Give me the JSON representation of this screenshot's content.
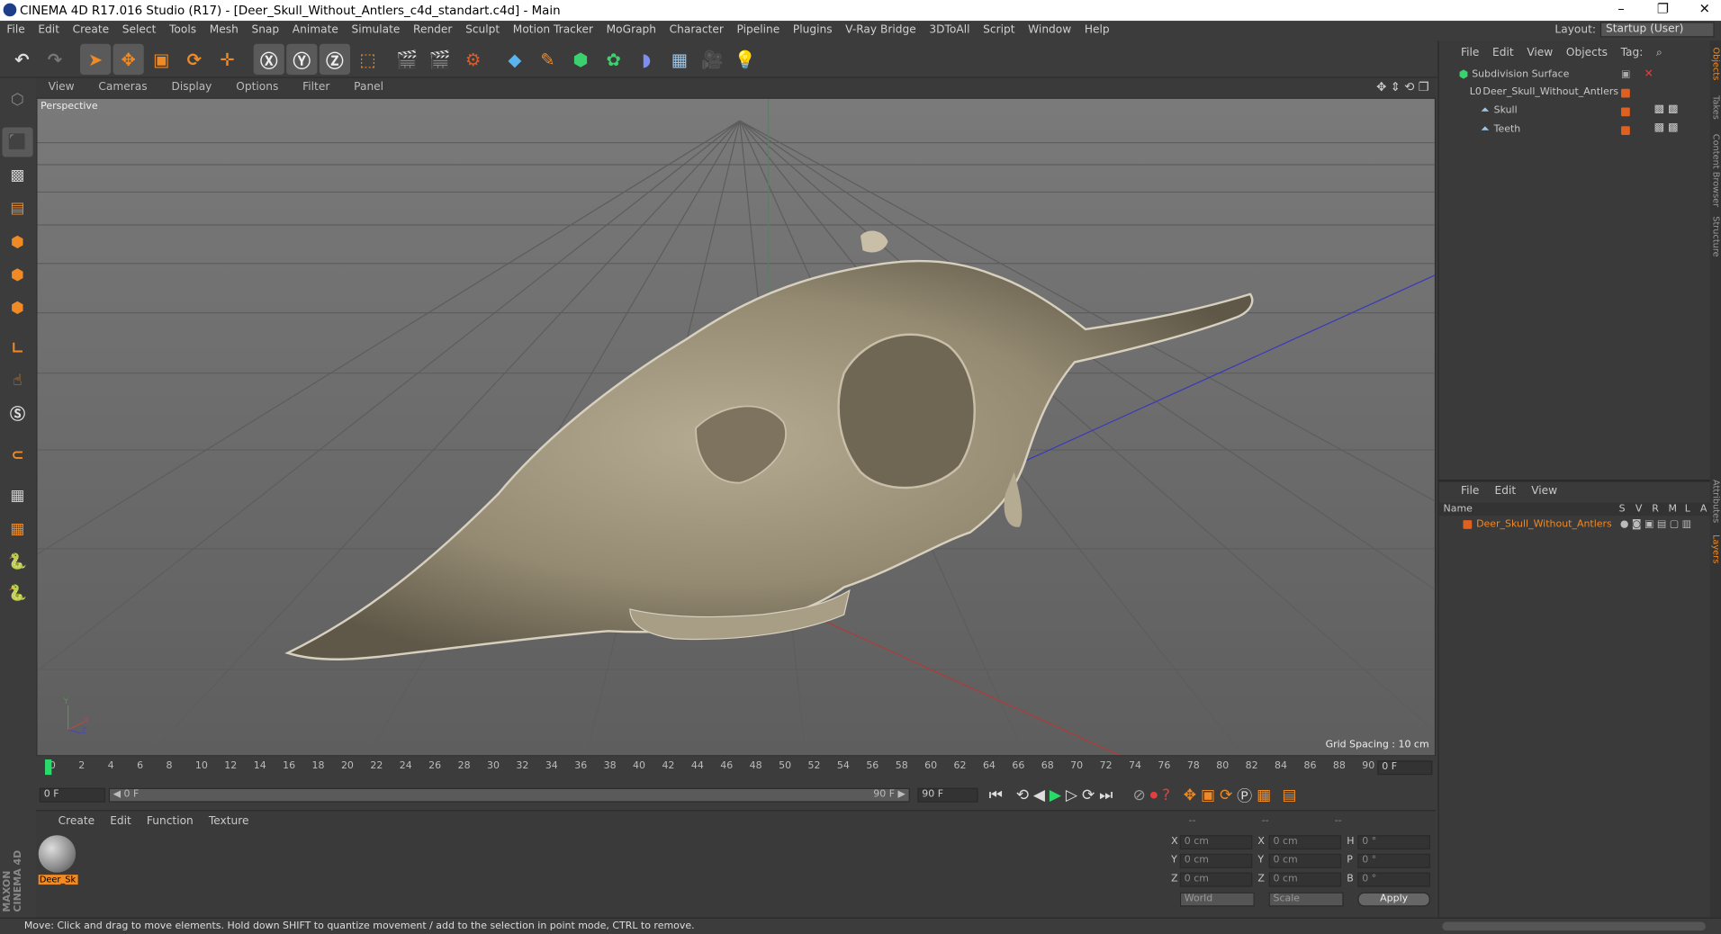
{
  "window": {
    "title": "CINEMA 4D R17.016 Studio (R17) - [Deer_Skull_Without_Antlers_c4d_standart.c4d] - Main",
    "controls": [
      "–",
      "❐",
      "✕"
    ]
  },
  "menubar": {
    "items": [
      "File",
      "Edit",
      "Create",
      "Select",
      "Tools",
      "Mesh",
      "Snap",
      "Animate",
      "Simulate",
      "Render",
      "Sculpt",
      "Motion Tracker",
      "MoGraph",
      "Character",
      "Pipeline",
      "Plugins",
      "V-Ray Bridge",
      "3DToAll",
      "Script",
      "Window",
      "Help"
    ],
    "layout_label": "Layout:",
    "layout_value": "Startup (User)"
  },
  "viewport": {
    "menu": [
      "View",
      "Cameras",
      "Display",
      "Options",
      "Filter",
      "Panel"
    ],
    "label": "Perspective",
    "grid_spacing": "Grid Spacing : 10 cm",
    "axis_labels": {
      "y": "Y",
      "x": "X",
      "z": "Z"
    }
  },
  "timeline": {
    "ticks": [
      "0",
      "2",
      "4",
      "6",
      "8",
      "10",
      "12",
      "14",
      "16",
      "18",
      "20",
      "22",
      "24",
      "26",
      "28",
      "30",
      "32",
      "34",
      "36",
      "38",
      "40",
      "42",
      "44",
      "46",
      "48",
      "50",
      "52",
      "54",
      "56",
      "58",
      "60",
      "62",
      "64",
      "66",
      "68",
      "70",
      "72",
      "74",
      "76",
      "78",
      "80",
      "82",
      "84",
      "86",
      "88",
      "90"
    ],
    "current_frame": "0 F"
  },
  "playbar": {
    "start_field": "0 F",
    "range_left": "◀ 0 F",
    "range_right": "90 F ▶",
    "end_field": "90 F"
  },
  "material_panel": {
    "menu": [
      "Create",
      "Edit",
      "Function",
      "Texture"
    ],
    "materials": [
      {
        "name": "Deer_Sk"
      }
    ],
    "maxon_logo": "MAXON",
    "cinema_logo": "CINEMA 4D"
  },
  "coord_panel": {
    "headers": [
      "--",
      "--",
      "--"
    ],
    "rows": [
      {
        "axis": "X",
        "pos": "0 cm",
        "axis2": "X",
        "size": "0 cm",
        "rot_axis": "H",
        "rot": "0 °"
      },
      {
        "axis": "Y",
        "pos": "0 cm",
        "axis2": "Y",
        "size": "0 cm",
        "rot_axis": "P",
        "rot": "0 °"
      },
      {
        "axis": "Z",
        "pos": "0 cm",
        "axis2": "Z",
        "size": "0 cm",
        "rot_axis": "B",
        "rot": "0 °"
      }
    ],
    "mode_world": "World",
    "mode_scale": "Scale",
    "apply": "Apply"
  },
  "object_manager": {
    "menu": [
      "File",
      "Edit",
      "View",
      "Objects",
      "Tag:"
    ],
    "objects": [
      {
        "name": "Subdivision Surface",
        "indent": 0
      },
      {
        "name": "Deer_Skull_Without_Antlers",
        "indent": 1
      },
      {
        "name": "Skull",
        "indent": 2
      },
      {
        "name": "Teeth",
        "indent": 2
      }
    ]
  },
  "layer_manager": {
    "menu": [
      "File",
      "Edit",
      "View"
    ],
    "columns": [
      "Name",
      "S",
      "V",
      "R",
      "M",
      "L",
      "A"
    ],
    "layers": [
      {
        "name": "Deer_Skull_Without_Antlers"
      }
    ]
  },
  "right_tabs": [
    "Objects",
    "Takes",
    "Content Browser",
    "Structure",
    "Attributes",
    "Layers"
  ],
  "status": {
    "text": "Move: Click and drag to move elements. Hold down SHIFT to quantize movement / add to the selection in point mode, CTRL to remove."
  },
  "colors": {
    "accent_orange": "#f08a24",
    "viewport_bg": "#6e6e6e",
    "panel_bg": "#3a3a3a"
  }
}
